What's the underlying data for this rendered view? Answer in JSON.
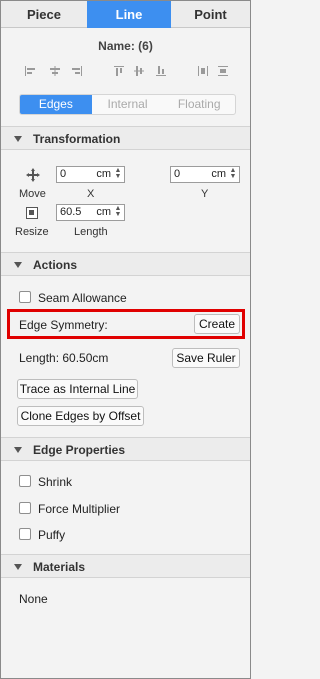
{
  "top_tabs": [
    {
      "label": "Piece"
    },
    {
      "label": "Line",
      "active": true
    },
    {
      "label": "Point"
    }
  ],
  "name": "Name: (6)",
  "align_icons": [
    "align-left-icon",
    "align-center-h-icon",
    "align-right-icon",
    "align-top-icon",
    "align-center-v-icon",
    "align-bottom-icon",
    "distribute-h-icon",
    "distribute-v-icon"
  ],
  "segments": [
    "Edges",
    "Internal",
    "Floating"
  ],
  "transformation": {
    "title": "Transformation",
    "move_label": "Move",
    "x": {
      "value": "0",
      "unit": "cm",
      "label": "X"
    },
    "y": {
      "value": "0",
      "unit": "cm",
      "label": "Y"
    },
    "resize_label": "Resize",
    "length": {
      "value": "60.5",
      "unit": "cm",
      "label": "Length"
    }
  },
  "actions": {
    "title": "Actions",
    "seam_allowance": "Seam Allowance",
    "edge_symmetry_label": "Edge Symmetry:",
    "create_label": "Create",
    "length_text": "Length: 60.50cm",
    "save_ruler_label": "Save Ruler",
    "trace_label": "Trace as Internal Line",
    "clone_label": "Clone Edges by Offset"
  },
  "edge_properties": {
    "title": "Edge Properties",
    "items": [
      "Shrink",
      "Force Multiplier",
      "Puffy"
    ]
  },
  "materials": {
    "title": "Materials",
    "value": "None"
  },
  "colors": {
    "accent": "#3d8ff0",
    "highlight": "#e00000"
  }
}
